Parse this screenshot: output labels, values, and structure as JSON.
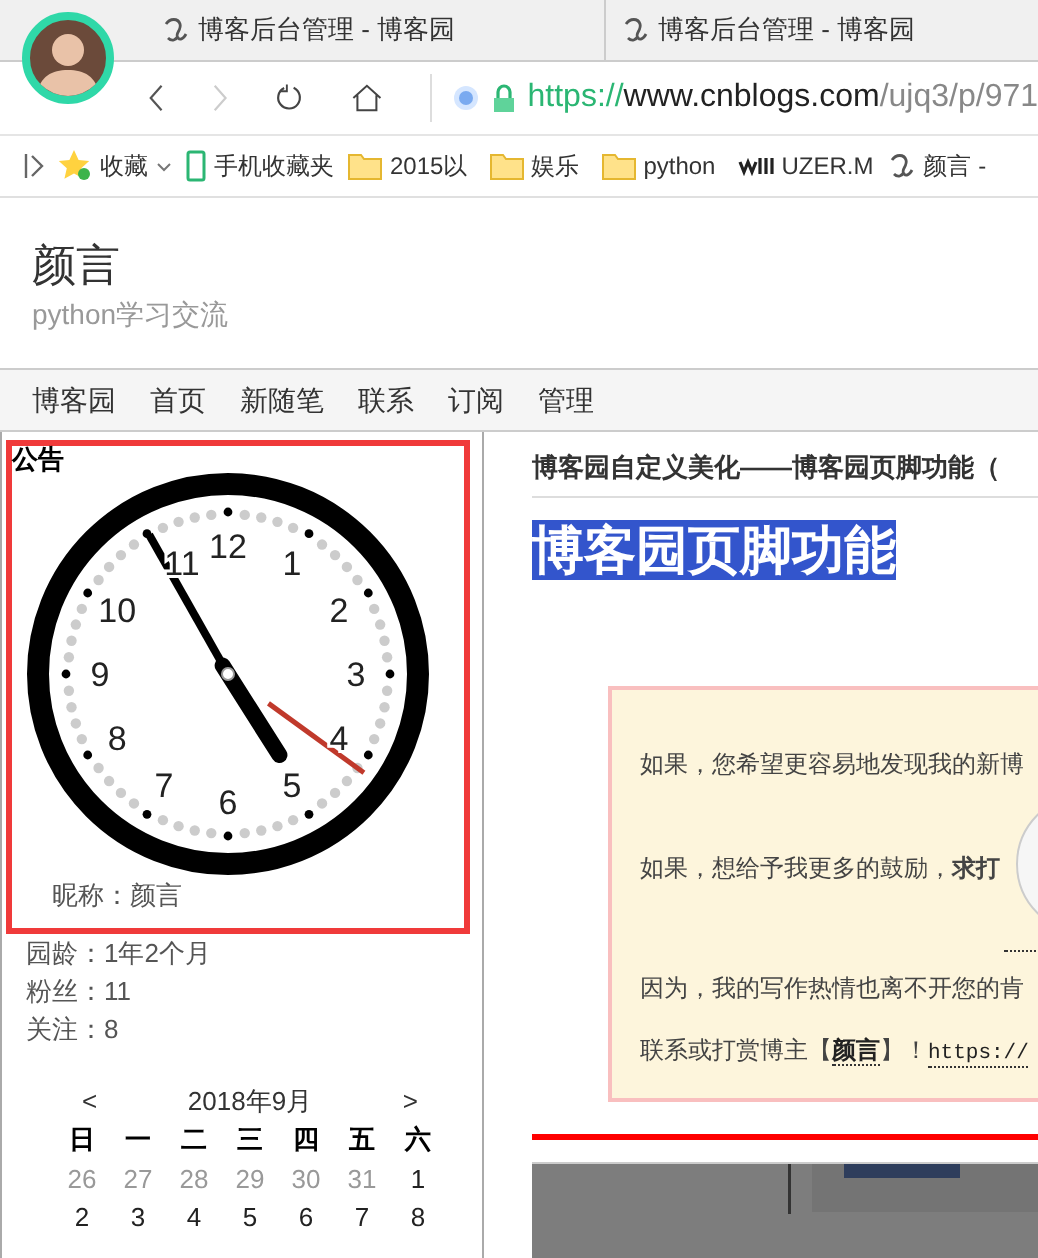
{
  "browser": {
    "tabs": [
      {
        "title": "博客后台管理 - 博客园"
      },
      {
        "title": "博客后台管理 - 博客园"
      }
    ],
    "url": {
      "scheme": "https://",
      "host": "www.cnblogs.com",
      "path": "/ujq3/p/971"
    },
    "bookmarks": [
      {
        "label": "收藏",
        "kind": "star"
      },
      {
        "label": "手机收藏夹",
        "kind": "phone"
      },
      {
        "label": "2015以",
        "kind": "folder"
      },
      {
        "label": "娱乐",
        "kind": "folder"
      },
      {
        "label": "python",
        "kind": "folder"
      },
      {
        "label": "UZER.M",
        "kind": "logo"
      },
      {
        "label": "颜言 -",
        "kind": "site"
      }
    ]
  },
  "blog": {
    "title": "颜言",
    "subtitle": "python学习交流"
  },
  "nav": [
    "博客园",
    "首页",
    "新随笔",
    "联系",
    "订阅",
    "管理"
  ],
  "sidebar": {
    "notice_title": "公告",
    "clock": {
      "numbers": [
        "12",
        "1",
        "2",
        "3",
        "4",
        "5",
        "6",
        "7",
        "8",
        "9",
        "10",
        "11"
      ]
    },
    "profile": [
      "昵称：颜言",
      "园龄：1年2个月",
      "粉丝：11",
      "关注：8"
    ],
    "calendar": {
      "prev": "<",
      "month": "2018年9月",
      "next": ">",
      "weekdays": [
        "日",
        "一",
        "二",
        "三",
        "四",
        "五",
        "六"
      ],
      "weeks": [
        [
          {
            "day": "26",
            "other_month": true
          },
          {
            "day": "27",
            "other_month": true
          },
          {
            "day": "28",
            "other_month": true
          },
          {
            "day": "29",
            "other_month": true
          },
          {
            "day": "30",
            "other_month": true
          },
          {
            "day": "31",
            "other_month": true
          },
          {
            "day": "1",
            "other_month": false
          }
        ],
        [
          {
            "day": "2",
            "other_month": false
          },
          {
            "day": "3",
            "other_month": false
          },
          {
            "day": "4",
            "other_month": false
          },
          {
            "day": "5",
            "other_month": false
          },
          {
            "day": "6",
            "other_month": false
          },
          {
            "day": "7",
            "other_month": false
          },
          {
            "day": "8",
            "other_month": false
          }
        ]
      ]
    }
  },
  "article": {
    "header": "博客园自定义美化——博客园页脚功能（",
    "heading": "博客园页脚功能",
    "footer_box": {
      "lines": [
        {
          "segments": [
            {
              "kind": "text",
              "text": "如果，您希望更容易地发现我的新博"
            }
          ]
        },
        {
          "segments": [
            {
              "kind": "text",
              "text": "如果，想给予我更多的鼓励，**求打**"
            }
          ]
        },
        {
          "segments": [
            {
              "kind": "text",
              "text": "因为，我的写作热情也离不开您的肯"
            }
          ]
        },
        {
          "segments": [
            {
              "kind": "text",
              "text": "联系或打赏博主【"
            },
            {
              "kind": "link",
              "text": "颜言"
            },
            {
              "kind": "text",
              "text": "】！"
            },
            {
              "kind": "url",
              "text": "https://"
            }
          ]
        }
      ]
    }
  }
}
